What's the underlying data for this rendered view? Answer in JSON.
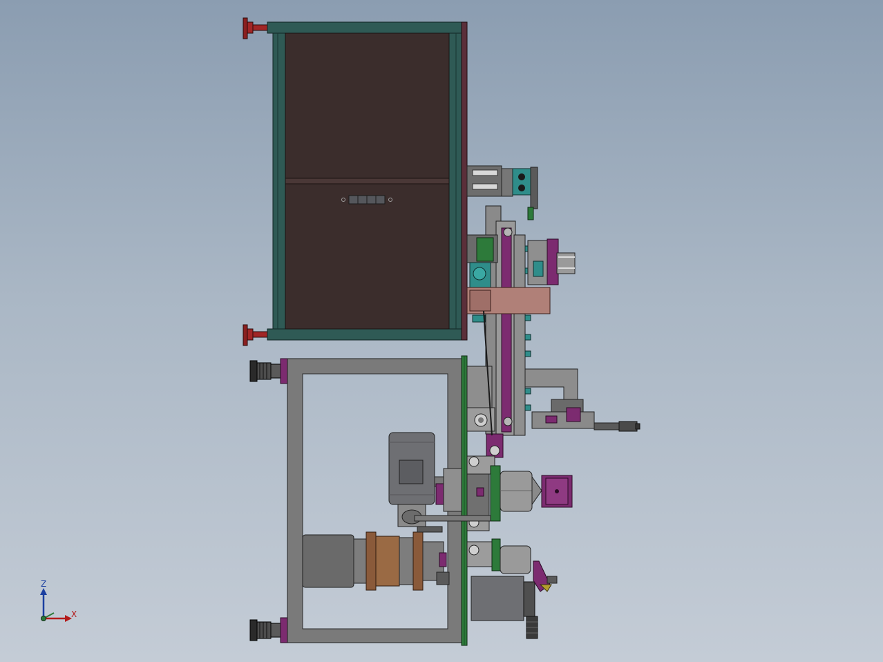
{
  "triad": {
    "z_label": "Z",
    "x_label": "X",
    "z_color": "#1b3fa0",
    "x_color": "#b31a1a"
  },
  "colors": {
    "background_top": "#8b9db1",
    "background_bottom": "#c4ccd6",
    "upper_frame": "#2f5a55",
    "upper_panel": "#3b2d2c",
    "lower_frame": "#7a7a7a",
    "accent_magenta": "#7c2b70",
    "accent_green": "#2d7a3a",
    "foot_red": "#8a1f1f",
    "motor_gray": "#6e6f73",
    "teal_parts": "#2f8d8a"
  }
}
